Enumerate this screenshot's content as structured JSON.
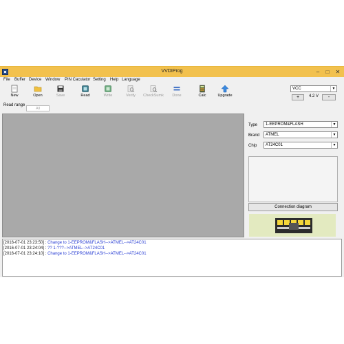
{
  "window": {
    "title": "VVDIProg"
  },
  "menu": [
    "File",
    "Buffer",
    "Device",
    "Window",
    "PIN Caculator",
    "Setting",
    "Help",
    "Language"
  ],
  "toolbar": {
    "new": "New",
    "open": "Open",
    "save": "Save",
    "read": "Read",
    "write": "Write",
    "verify": "Verify",
    "checksum": "CheckSumk",
    "done": "Done",
    "calc": "Calc",
    "upgrade": "Upgrade"
  },
  "vcc": {
    "select": "VCC",
    "plus": "+",
    "voltage": "4.2 V",
    "minus": "-"
  },
  "read_range": {
    "label": "Read range",
    "value": "All"
  },
  "side": {
    "type_label": "Type",
    "type_value": "1-EEPROM&FLASH",
    "brand_label": "Brand",
    "brand_value": "ATMEL",
    "chip_label": "Chip",
    "chip_value": "AT24C01",
    "connection_button": "Connection diagram"
  },
  "log": [
    {
      "ts": "[2016-07-01 23:23:50] : ",
      "msg": "Change to 1-EEPROM&FLASH-->ATMEL-->AT24C01"
    },
    {
      "ts": "[2016-07-01 23:24:04] : ",
      "msg": "?? 1-???-->ATMEL-->AT24C01"
    },
    {
      "ts": "[2016-07-01 23:24:10] : ",
      "msg": "Change to 1-EEPROM&FLASH-->ATMEL-->AT24C01"
    }
  ],
  "colors": {
    "titlebar": "#f2c14e",
    "log_text": "#2a3fd4",
    "hex_area": "#a9a9a9"
  }
}
